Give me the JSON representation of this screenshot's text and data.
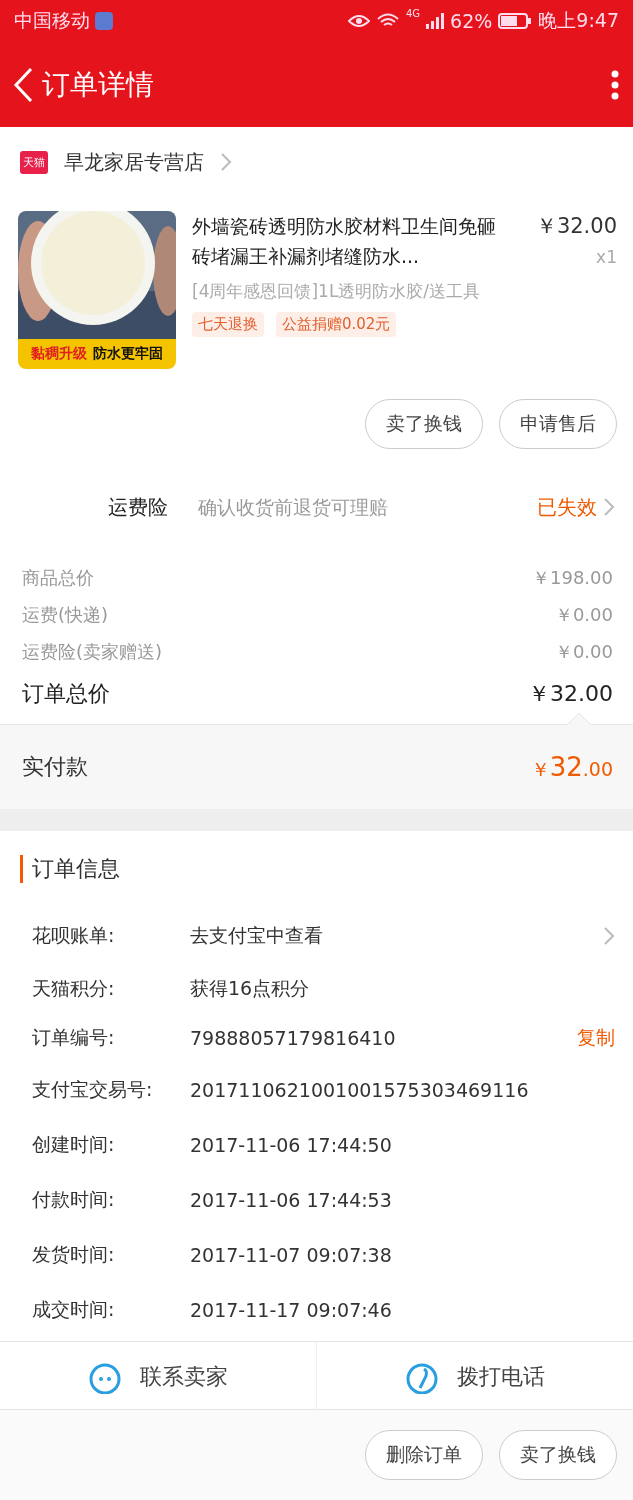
{
  "status_bar": {
    "carrier": "中国移动",
    "network": "4G",
    "battery": "62%",
    "time": "晚上9:47"
  },
  "header": {
    "title": "订单详情"
  },
  "store": {
    "badge": "天猫",
    "name": "旱龙家居专营店"
  },
  "product": {
    "image_caption_1": "黏稠升级",
    "image_caption_2": "防水更牢固",
    "title": "外墙瓷砖透明防水胶材料卫生间免砸砖堵漏王补漏剂堵缝防水...",
    "price": "￥32.00",
    "quantity": "x1",
    "sku": "[4周年感恩回馈]1L透明防水胶/送工具",
    "tags": [
      "七天退换",
      "公益捐赠0.02元"
    ]
  },
  "item_buttons": [
    "卖了换钱",
    "申请售后"
  ],
  "insurance": {
    "label": "运费险",
    "description": "确认收货前退货可理赔",
    "status": "已失效"
  },
  "price_rows": [
    {
      "label": "商品总价",
      "value": "￥198.00",
      "kind": "minor"
    },
    {
      "label": "运费(快递)",
      "value": "￥0.00",
      "kind": "minor"
    },
    {
      "label": "运费险(卖家赠送)",
      "value": "￥0.00",
      "kind": "minor"
    },
    {
      "label": "订单总价",
      "value": "￥32.00",
      "kind": "total"
    }
  ],
  "paid": {
    "label": "实付款",
    "currency": "￥",
    "integer": "32",
    "decimal": ".00"
  },
  "order_info": {
    "title": "订单信息",
    "rows": [
      {
        "label": "花呗账单:",
        "value": "去支付宝中查看",
        "kind": "link"
      },
      {
        "label": "天猫积分:",
        "value": "获得16点积分",
        "kind": "plain"
      },
      {
        "label": "订单编号:",
        "value": "79888057179816410",
        "kind": "copy",
        "action": "复制"
      },
      {
        "label": "支付宝交易号:",
        "value": "2017110621001001575303469116",
        "kind": "plain"
      },
      {
        "label": "创建时间:",
        "value": "2017-11-06 17:44:50",
        "kind": "plain"
      },
      {
        "label": "付款时间:",
        "value": "2017-11-06 17:44:53",
        "kind": "plain"
      },
      {
        "label": "发货时间:",
        "value": "2017-11-07 09:07:38",
        "kind": "plain"
      },
      {
        "label": "成交时间:",
        "value": "2017-11-17 09:07:46",
        "kind": "plain"
      }
    ]
  },
  "contact": [
    "联系卖家",
    "拨打电话"
  ],
  "bottom_buttons": [
    "删除订单",
    "卖了换钱"
  ]
}
